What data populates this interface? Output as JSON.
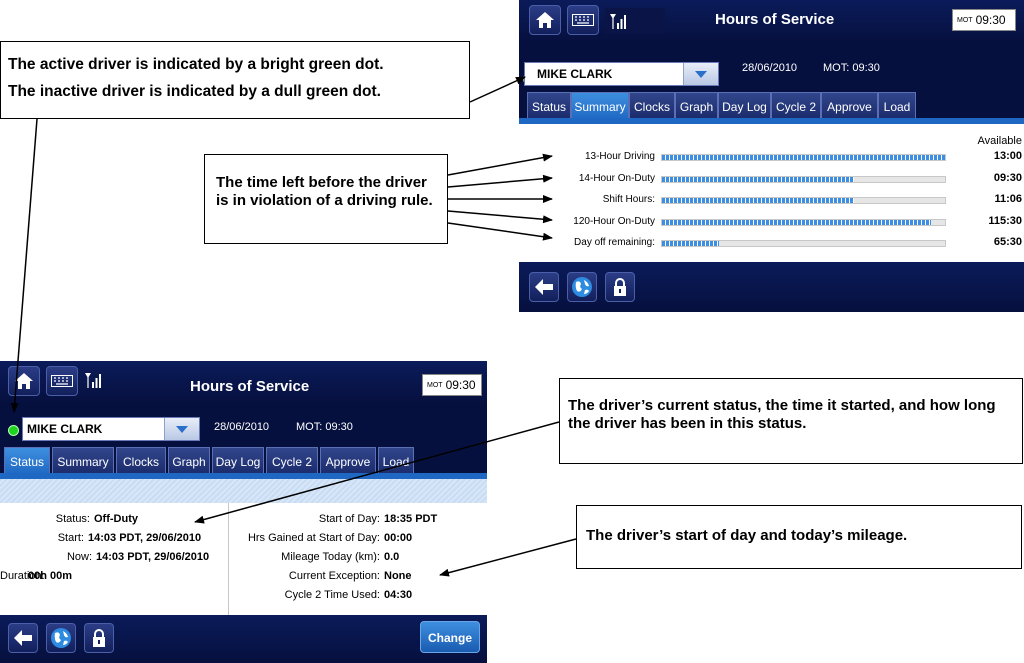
{
  "callouts": {
    "driver_dot": {
      "line1": "The active driver is indicated by a bright green dot.",
      "line2": "The inactive driver is indicated by a dull green dot."
    },
    "time_left": "The time left before the driver is in violation of a driving rule.",
    "current_status": "The driver’s current status, the time it started, and how long the driver has been in this status.",
    "start_of_day": "The driver’s start of day and today’s mileage."
  },
  "colors": {
    "header_navy": "#06103e",
    "tab_active": "#1e67c2",
    "bar_blue": "#3c8fe2",
    "active_dot": "#1ed41e",
    "inactive_dot": "#2f7a2f"
  },
  "summary_screen": {
    "title": "Hours of Service",
    "clock_prefix": "MOT",
    "clock_time": "09:30",
    "driver_name": "MIKE CLARK",
    "date": "28/06/2010",
    "mot": "MOT: 09:30",
    "tabs": [
      "Status",
      "Summary",
      "Clocks",
      "Graph",
      "Day Log",
      "Cycle 2",
      "Approve",
      "Load"
    ],
    "active_tab": "Summary",
    "available_header": "Available",
    "rows": [
      {
        "label": "13-Hour Driving",
        "value": "13:00",
        "fill": 1.0
      },
      {
        "label": "14-Hour On-Duty",
        "value": "09:30",
        "fill": 0.68
      },
      {
        "label": "Shift Hours:",
        "value": "11:06",
        "fill": 0.68
      },
      {
        "label": "120-Hour On-Duty",
        "value": "115:30",
        "fill": 0.95
      },
      {
        "label": "Day off remaining:",
        "value": "65:30",
        "fill": 0.2
      }
    ]
  },
  "status_screen": {
    "title": "Hours of Service",
    "clock_prefix": "MOT",
    "clock_time": "09:30",
    "driver_name": "MIKE CLARK",
    "date": "28/06/2010",
    "mot": "MOT: 09:30",
    "tabs": [
      "Status",
      "Summary",
      "Clocks",
      "Graph",
      "Day Log",
      "Cycle 2",
      "Approve",
      "Load"
    ],
    "active_tab": "Status",
    "left": [
      {
        "label": "Status:",
        "value": "Off-Duty"
      },
      {
        "label": "Start:",
        "value": "14:03 PDT, 29/06/2010"
      },
      {
        "label": "Now:",
        "value": "14:03 PDT, 29/06/2010"
      },
      {
        "label": "Duration:",
        "value": "00h 00m"
      }
    ],
    "right": [
      {
        "label": "Start of Day:",
        "value": "18:35 PDT"
      },
      {
        "label": "Hrs Gained at Start of Day:",
        "value": "00:00"
      },
      {
        "label": "Mileage Today (km):",
        "value": "0.0"
      },
      {
        "label": "Current Exception:",
        "value": "None"
      },
      {
        "label": "Cycle 2 Time Used:",
        "value": "04:30"
      }
    ],
    "change_button": "Change"
  },
  "icons": [
    "home-icon",
    "keyboard-icon",
    "signal-icon",
    "back-arrow-icon",
    "globe-icon",
    "lock-icon",
    "dropdown-arrow-icon"
  ]
}
